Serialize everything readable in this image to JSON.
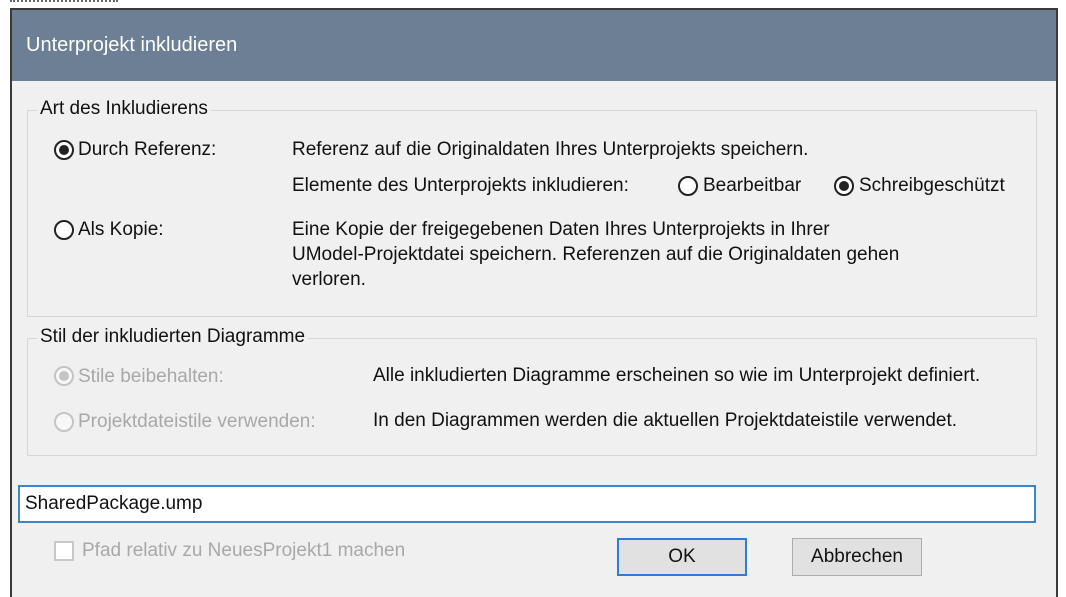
{
  "dialog": {
    "title": "Unterprojekt inkludieren"
  },
  "include_type": {
    "legend": "Art des Inkludierens",
    "by_reference": {
      "label": "Durch Referenz:",
      "description": "Referenz auf die Originaldaten Ihres Unterprojekts speichern.",
      "elements_label": "Elemente des Unterprojekts inkludieren:",
      "editable_label": "Bearbeitbar",
      "readonly_label": "Schreibgeschützt"
    },
    "as_copy": {
      "label": "Als Kopie:",
      "description_line1": "Eine Kopie der freigegebenen Daten Ihres Unterprojekts in Ihrer",
      "description_line2": "UModel-Projektdatei speichern. Referenzen auf die Originaldaten gehen",
      "description_line3": "verloren."
    }
  },
  "diagram_style": {
    "legend": "Stil der inkludierten Diagramme",
    "keep_styles": {
      "label": "Stile beibehalten:",
      "description": "Alle inkludierten Diagramme erscheinen so wie im Unterprojekt definiert."
    },
    "project_styles": {
      "label": "Projektdateistile verwenden:",
      "description": "In den Diagrammen werden die aktuellen Projektdateistile verwendet."
    }
  },
  "file_path": {
    "value": "SharedPackage.ump"
  },
  "relative_path": {
    "label": "Pfad relativ zu NeuesProjekt1 machen",
    "checked": false
  },
  "buttons": {
    "ok": "OK",
    "cancel": "Abbrechen"
  }
}
